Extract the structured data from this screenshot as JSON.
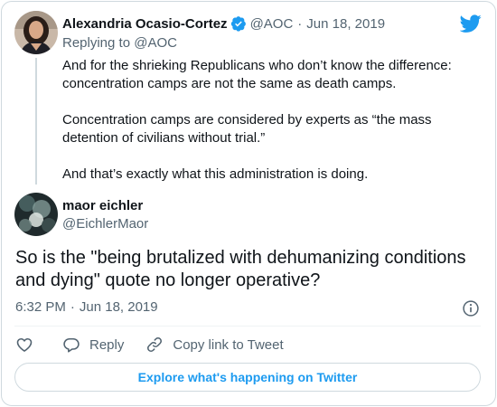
{
  "parent_tweet": {
    "author_name": "Alexandria Ocasio-Cortez",
    "handle": "@AOC",
    "date": "Jun 18, 2019",
    "replying_prefix": "Replying to",
    "replying_handle": "@AOC",
    "paragraphs": [
      "And for the shrieking Republicans who don’t know the difference: concentration camps are not the same as death camps.",
      "Concentration camps are considered by experts as “the mass detention of civilians without trial.”",
      "And that’s exactly what this administration is doing."
    ]
  },
  "reply_tweet": {
    "author_name": "maor eichler",
    "handle": "@EichlerMaor",
    "text": "So is the \"being brutalized with dehumanizing conditions and dying\" quote no longer operative?",
    "time": "6:32 PM",
    "date": "Jun 18, 2019"
  },
  "actions": {
    "like_icon": "heart-icon",
    "reply_label": "Reply",
    "copy_label": "Copy link to Tweet"
  },
  "footer": {
    "explore_label": "Explore what's happening on Twitter"
  },
  "colors": {
    "brand": "#1d9bf0",
    "text": "#0f1419",
    "muted": "#536471",
    "border": "#cfd9de"
  }
}
